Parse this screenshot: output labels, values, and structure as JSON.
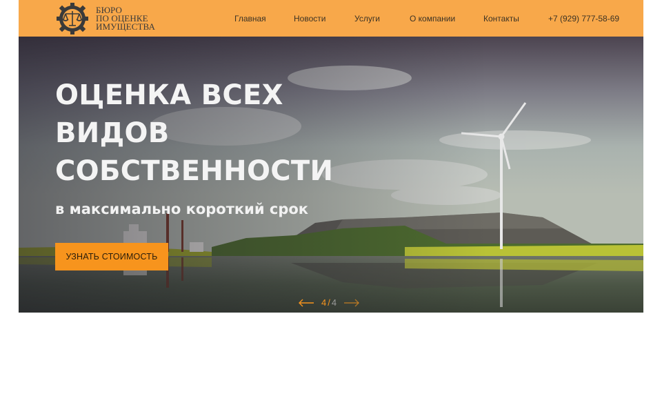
{
  "brand": {
    "line1": "БЮРО",
    "line2": "ПО ОЦЕНКЕ",
    "line3": "ИМУЩЕСТВА"
  },
  "nav": [
    {
      "label": "Главная"
    },
    {
      "label": "Новости"
    },
    {
      "label": "Услуги"
    },
    {
      "label": "О компании"
    },
    {
      "label": "Контакты"
    },
    {
      "label": "+7 (929) 777-58-69"
    }
  ],
  "hero": {
    "title_lines": [
      "ОЦЕНКА ВСЕХ",
      "ВИДОВ",
      "СОБСТВЕННОСТИ"
    ],
    "subtitle": "в максимально короткий срок",
    "cta": "УЗНАТЬ СТОИМОСТЬ"
  },
  "slider": {
    "current": "4",
    "separator": "/",
    "total": "4"
  },
  "colors": {
    "header_bg": "#f8a84a",
    "accent": "#f7941d"
  },
  "icons": {
    "prev": "arrow-left-icon",
    "next": "arrow-right-icon",
    "logo": "gear-scales-logo"
  }
}
